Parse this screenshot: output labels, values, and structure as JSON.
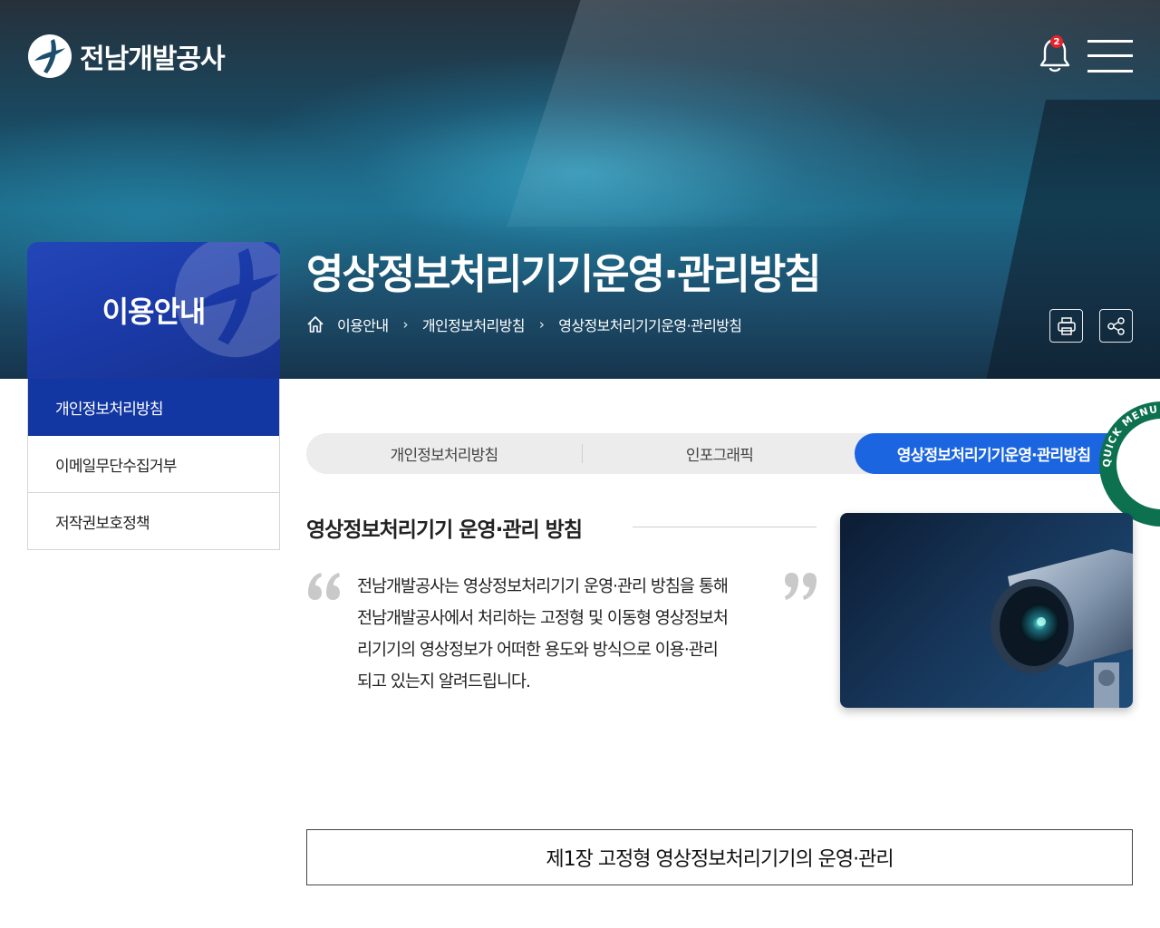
{
  "header": {
    "logo_text": "전남개발공사",
    "notification_count": "2"
  },
  "hero": {
    "section_title": "이용안내",
    "page_title": "영상정보처리기기운영·관리방침",
    "breadcrumb": [
      "이용안내",
      "개인정보처리방침",
      "영상정보처리기기운영·관리방침"
    ]
  },
  "side_nav": {
    "items": [
      {
        "label": "개인정보처리방침",
        "active": true
      },
      {
        "label": "이메일무단수집거부",
        "active": false
      },
      {
        "label": "저작권보호정책",
        "active": false
      }
    ]
  },
  "tabs": [
    {
      "label": "개인정보처리방침",
      "active": false
    },
    {
      "label": "인포그래픽",
      "active": false
    },
    {
      "label": "영상정보처리기기운영·관리방침",
      "active": true
    }
  ],
  "quick_menu": {
    "label": "QUICK MENU SERVICE"
  },
  "content": {
    "title": "영상정보처리기기 운영·관리 방침",
    "quote_lines": [
      "전남개발공사는 영상정보처리기기 운영·관리 방침을 통해",
      "전남개발공사에서 처리하는 고정형 및 이동형 영상정보처",
      "리기기의 영상정보가 어떠한 용도와 방식으로 이용·관리",
      "되고 있는지 알려드립니다."
    ],
    "chapter_title": "제1장 고정형 영상정보처리기기의 운영·관리"
  },
  "colors": {
    "primary_blue": "#1337a2",
    "tab_active_blue": "#1b66e0",
    "quick_menu_green": "#0d7150",
    "badge_red": "#e6232b"
  },
  "icons": [
    "logo-icon",
    "bell-icon",
    "hamburger-menu-icon",
    "home-icon",
    "chevron-right-icon",
    "print-icon",
    "share-icon",
    "quote-open-icon",
    "quote-close-icon",
    "cctv-camera-image"
  ]
}
